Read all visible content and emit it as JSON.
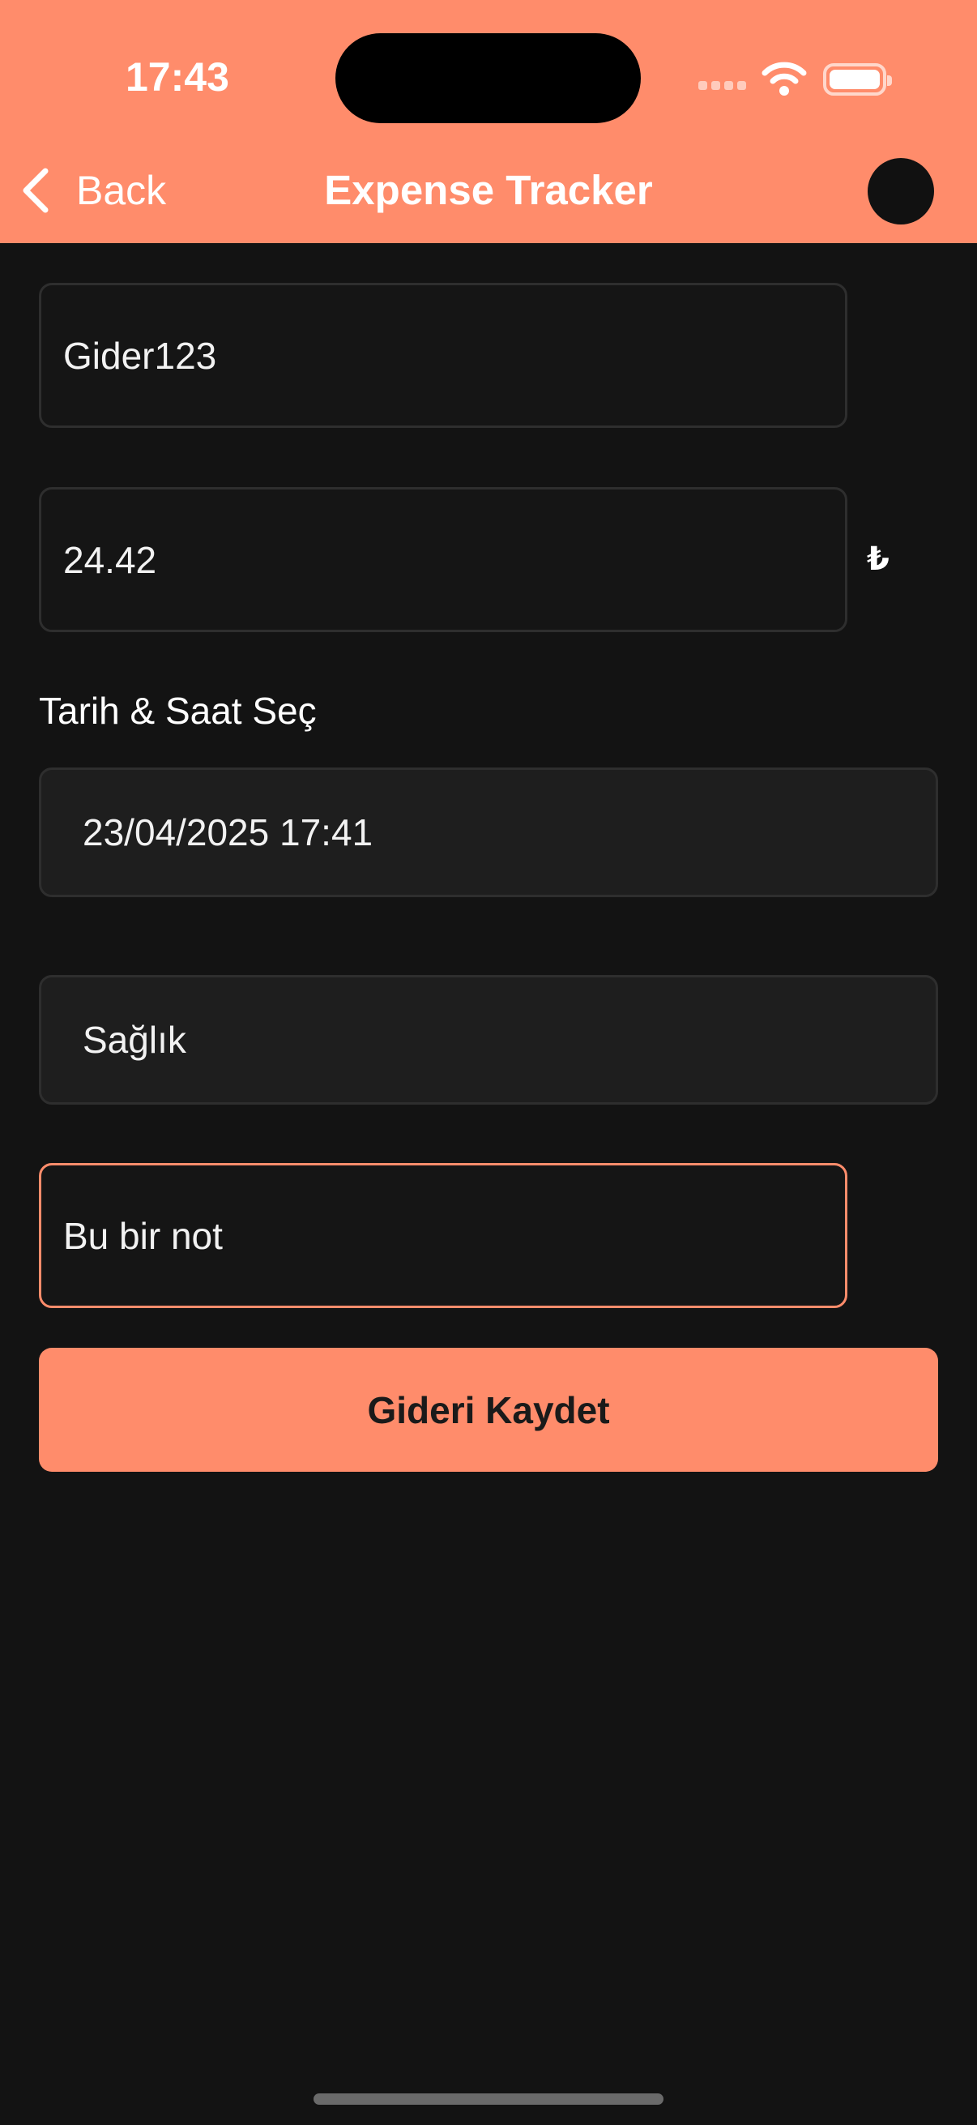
{
  "status_bar": {
    "time": "17:43"
  },
  "nav": {
    "back_label": "Back",
    "title": "Expense Tracker"
  },
  "form": {
    "name_value": "Gider123",
    "amount_value": "24.42",
    "currency_symbol": "₺",
    "datetime_label": "Tarih & Saat Seç",
    "datetime_value": "23/04/2025 17:41",
    "category_value": "Sağlık",
    "note_value": "Bu bir not",
    "save_label": "Gideri Kaydet"
  },
  "colors": {
    "accent": "#FF8C6B",
    "background": "#131313",
    "field_border": "#2e2e2e"
  },
  "icons": {
    "back": "chevron-left-icon",
    "wifi": "wifi-icon",
    "battery": "battery-icon",
    "signal": "cellular-signal-icon"
  }
}
